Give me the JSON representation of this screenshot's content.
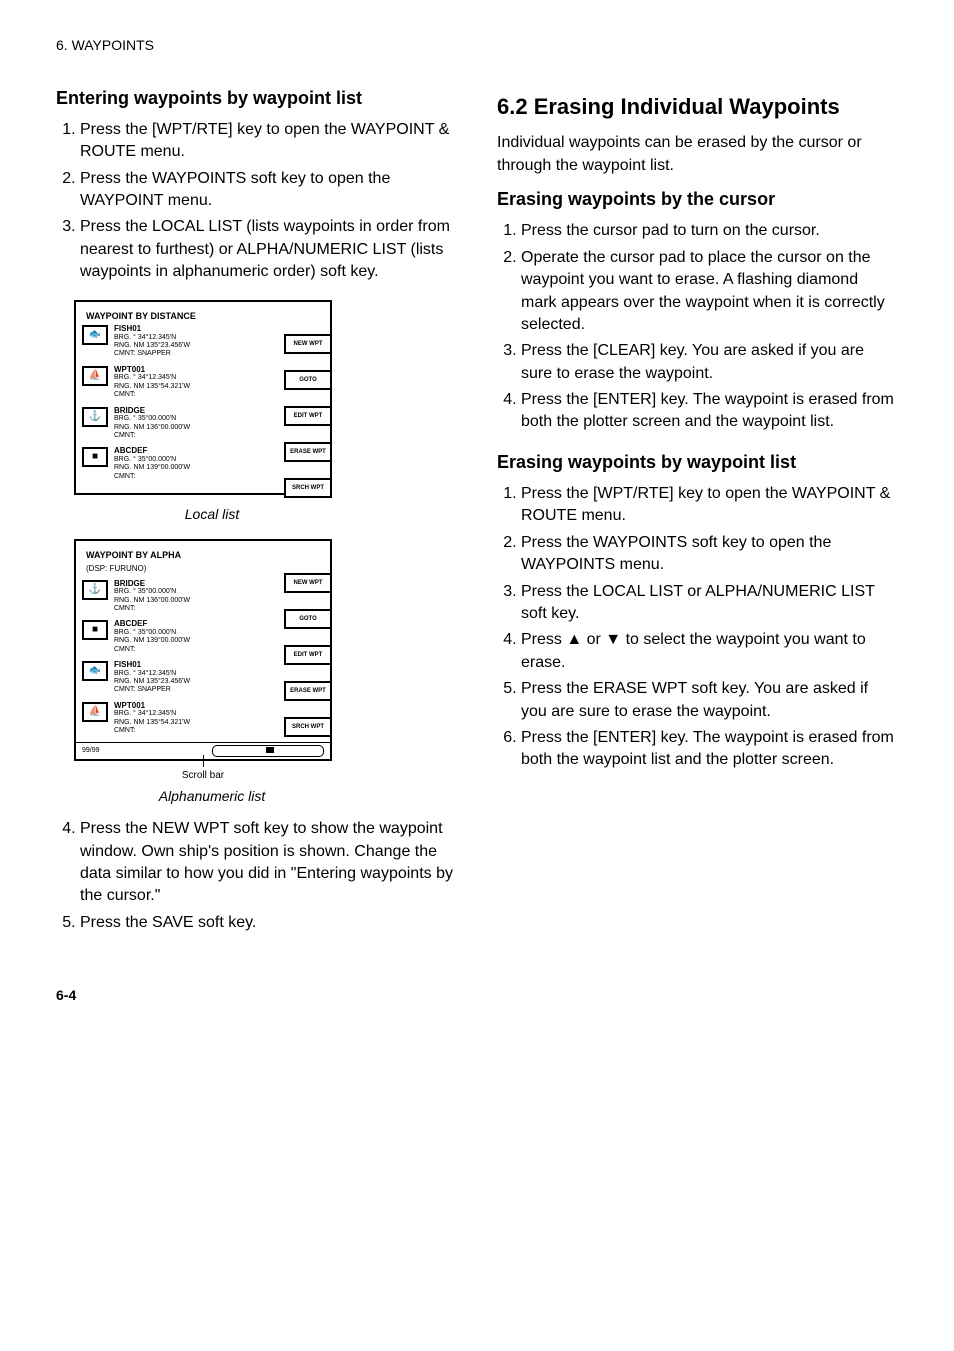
{
  "header": "6. WAYPOINTS",
  "left": {
    "sec_title": "Entering waypoints by waypoint list",
    "steps_a": [
      "Press the [WPT/RTE] key to open the WAYPOINT & ROUTE menu.",
      "Press the WAYPOINTS soft key to open the WAYPOINT menu.",
      "Press the LOCAL LIST (lists waypoints in order from nearest to furthest) or ALPHA/NUMERIC LIST (lists waypoints in alphanumeric order) soft key."
    ],
    "local": {
      "title": "WAYPOINT BY DISTANCE",
      "rows": [
        {
          "name": "FISH01",
          "brg": "BRG.   °",
          "rng": "RNG.  NM",
          "lat": "34°12.345'N",
          "lon": "135°23.456'W",
          "cmt": "CMNT: SNAPPER"
        },
        {
          "name": "WPT001",
          "brg": "BRG.   °",
          "rng": "RNG.  NM",
          "lat": "34°12.345'N",
          "lon": "135°54.321'W",
          "cmt": "CMNT:"
        },
        {
          "name": "BRIDGE",
          "brg": "BRG.   °",
          "rng": "RNG.  NM",
          "lat": "35°00.000'N",
          "lon": "136°00.000'W",
          "cmt": "CMNT:"
        },
        {
          "name": "ABCDEF",
          "brg": "BRG.   °",
          "rng": "RNG.  NM",
          "lat": "35°00.000'N",
          "lon": "139°00.000'W",
          "cmt": "CMNT:"
        }
      ],
      "softkeys": [
        "NEW WPT",
        "GOTO",
        "EDIT WPT",
        "ERASE WPT",
        "SRCH WPT"
      ],
      "caption": "Local list"
    },
    "alpha": {
      "title": "WAYPOINT BY ALPHA",
      "sub": "(DSP: FURUNO)",
      "rows": [
        {
          "name": "BRIDGE",
          "brg": "BRG.   °",
          "rng": "RNG.  NM",
          "lat": "35°00.000'N",
          "lon": "136°00.000'W",
          "cmt": "CMNT:"
        },
        {
          "name": "ABCDEF",
          "brg": "BRG.   °",
          "rng": "RNG.  NM",
          "lat": "35°00.000'N",
          "lon": "139°00.000'W",
          "cmt": "CMNT:"
        },
        {
          "name": "FISH01",
          "brg": "BRG.   °",
          "rng": "RNG.  NM",
          "lat": "34°12.345'N",
          "lon": "135°23.456'W",
          "cmt": "CMNT: SNAPPER"
        },
        {
          "name": "WPT001",
          "brg": "BRG.   °",
          "rng": "RNG.  NM",
          "lat": "34°12.345'N",
          "lon": "135°54.321'W",
          "cmt": "CMNT:"
        }
      ],
      "softkeys": [
        "NEW WPT",
        "GOTO",
        "EDIT WPT",
        "ERASE WPT",
        "SRCH WPT"
      ],
      "foot_left": "99/99",
      "scroll_label": "Scroll bar",
      "caption": "Alphanumeric list"
    },
    "steps_b": [
      "Press the NEW WPT soft key to show the waypoint window. Own ship's position is shown. Change the data similar to how you did in \"Entering waypoints by the cursor.\"",
      "Press the SAVE soft key."
    ]
  },
  "right": {
    "sec_title": "6.2 Erasing Individual Waypoints",
    "intro": "Individual waypoints can be erased by the cursor or through the waypoint list.",
    "sub1": "Erasing waypoints by the cursor",
    "steps1": [
      "Press the cursor pad to turn on the cursor.",
      "Operate the cursor pad to place the cursor on the waypoint you want to erase. A flashing diamond mark appears over the waypoint when it is correctly selected.",
      "Press the [CLEAR] key. You are asked if you are sure to erase the waypoint.",
      "Press the [ENTER] key. The waypoint is erased from both the plotter screen and the waypoint list."
    ],
    "sub2": "Erasing waypoints by waypoint list",
    "steps2": [
      "Press the [WPT/RTE] key to open the WAYPOINT & ROUTE menu.",
      "Press the WAYPOINTS soft key to open the WAYPOINTS menu.",
      "Press the LOCAL LIST or ALPHA/NUMERIC LIST soft key.",
      "Press ▲ or ▼ to select the waypoint you want to erase.",
      "Press the ERASE WPT soft key. You are asked if you are sure to erase the waypoint.",
      "Press the [ENTER] key. The waypoint is erased from both the waypoint list and the plotter screen."
    ]
  },
  "page_number": "6-4"
}
